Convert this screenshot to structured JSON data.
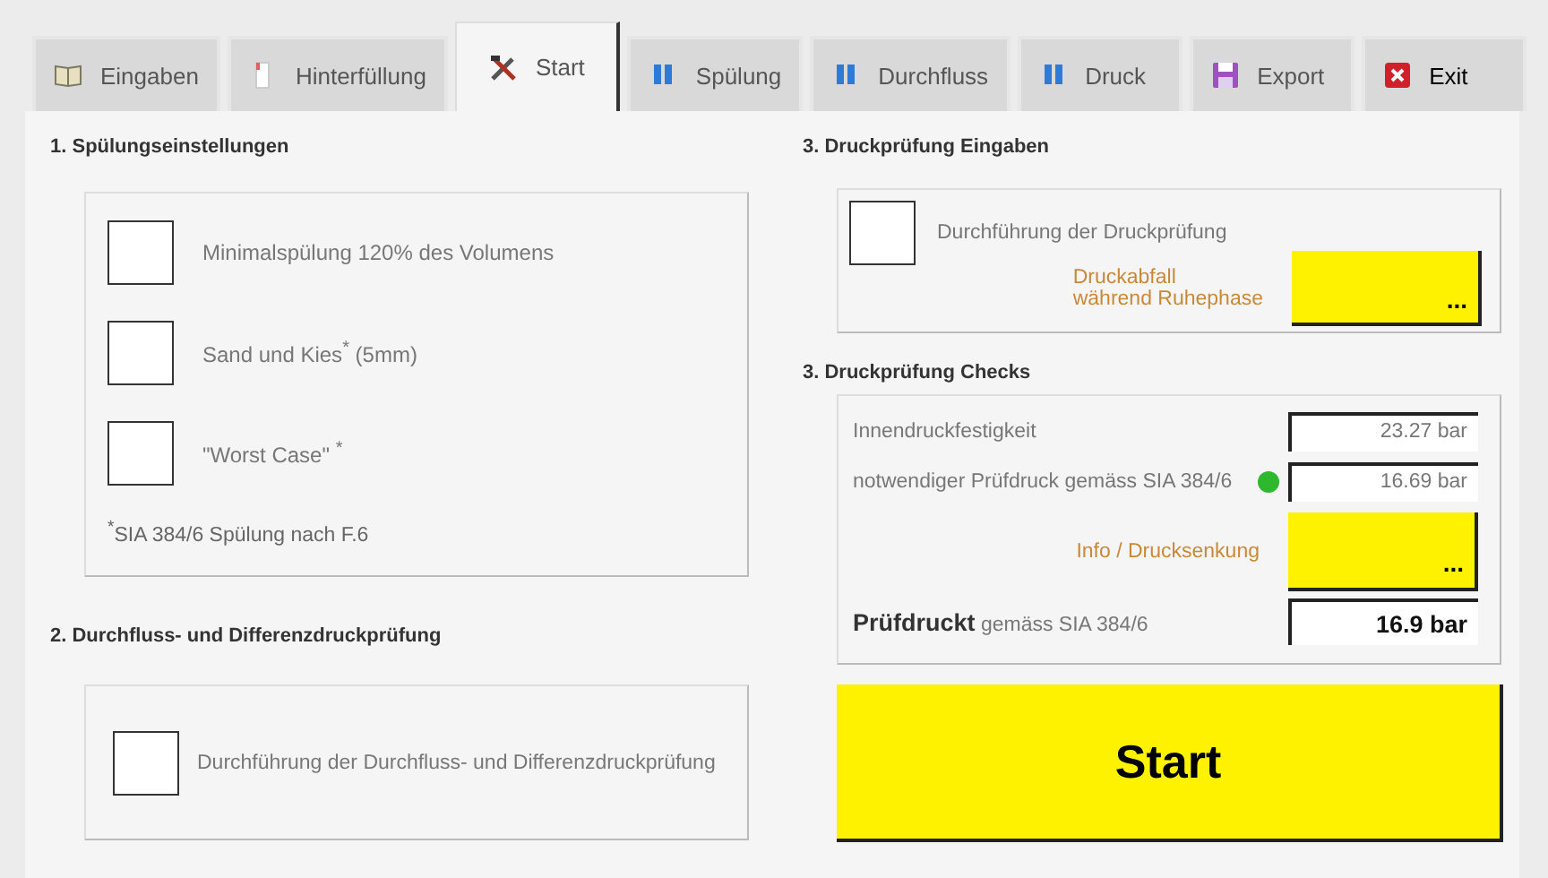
{
  "tabs": [
    {
      "label": "Eingaben",
      "selected": false
    },
    {
      "label": "Hinterfüllung",
      "selected": false
    },
    {
      "label": "Start",
      "selected": true
    },
    {
      "label": "Spülung",
      "selected": false
    },
    {
      "label": "Durchfluss",
      "selected": false
    },
    {
      "label": "Druck",
      "selected": false
    },
    {
      "label": "Export",
      "selected": false
    },
    {
      "label": "Exit",
      "selected": false
    }
  ],
  "flush_settings": {
    "title": "1. Spülungseinstellungen",
    "options": [
      {
        "label": "Minimalspülung 120% des Volumens",
        "checked": false
      },
      {
        "label": "Sand und Kies$^{*}$ (5mm)",
        "checked": false
      },
      {
        "label": "\"Worst Case\" $^{*}$",
        "checked": false
      }
    ],
    "footnote": "$^{*}$SIA 384/6 Spülung nach F.6"
  },
  "flow_test": {
    "title": "2. Durchfluss- und Differenzdruckprüfung",
    "option": {
      "label": "Durchführung der Durchfluss- und Differenzdruckprüfung",
      "checked": false
    }
  },
  "pressure_inputs": {
    "title": "3. Druckprüfung Eingaben",
    "option": {
      "label": "Durchführung der Druckprüfung",
      "checked": false
    },
    "drop_label": "Druckabfall\nwährend Ruhephase",
    "drop_button": "..."
  },
  "pressure_checks": {
    "title": "3. Druckprüfung Checks",
    "rows": [
      {
        "label": "Innendruckfestigkeit",
        "value": "23.27 bar"
      },
      {
        "label": "notwendiger Prüfdruck gemäss SIA 384/6",
        "value": "16.69 bar",
        "color": "#2eb82e"
      }
    ],
    "info_label": "Info / Drucksenkung",
    "info_button": "...",
    "result_label": "**Prüfdruckt** gemäss SIA 384/6",
    "result_value": "16.9 bar"
  },
  "start_button": "Start"
}
